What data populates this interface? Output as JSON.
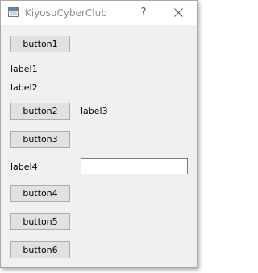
{
  "window": {
    "title": "KiyosuCyberClub",
    "help_glyph": "?"
  },
  "buttons": [
    "button1",
    "button2",
    "button3",
    "button4",
    "button5",
    "button6"
  ],
  "labels": [
    "label1",
    "label2",
    "label3",
    "label4"
  ],
  "textbox": {
    "value": ""
  },
  "colors": {
    "window_bg": "#f0f0f0",
    "button_bg": "#e1e1e1",
    "button_border": "#adadad",
    "titlebar_bg": "#ffffff"
  }
}
